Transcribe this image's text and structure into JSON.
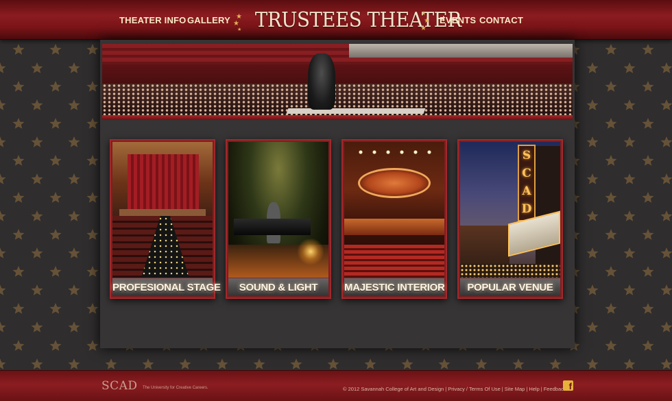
{
  "header": {
    "nav_left": [
      "THEATER INFO",
      "GALLERY"
    ],
    "brand_title": "TRUSTEES THEATER",
    "nav_right": [
      "EVENTS",
      "CONTACT"
    ]
  },
  "cards": [
    {
      "label": "PROFESIONAL STAGE"
    },
    {
      "label": "SOUND & LIGHT"
    },
    {
      "label": "MAJESTIC INTERIOR"
    },
    {
      "label": "POPULAR VENUE"
    }
  ],
  "venue_photo": {
    "tower_letters": [
      "S",
      "C",
      "A",
      "D"
    ]
  },
  "footer": {
    "logo": "SCAD",
    "tagline": "The University for Creative Careers.",
    "copyright": "© 2012 Savannah College of Art and Design",
    "links": [
      "Privacy / Terms Of Use",
      "Site Map",
      "Help",
      "Feedback"
    ],
    "facebook_icon": "facebook-icon"
  },
  "colors": {
    "header_red": "#8b1c20",
    "nav_text": "#fbe9c6",
    "star_gold": "#e3b255",
    "panel_bg": "#363434",
    "footer_red": "#8b1d21"
  }
}
